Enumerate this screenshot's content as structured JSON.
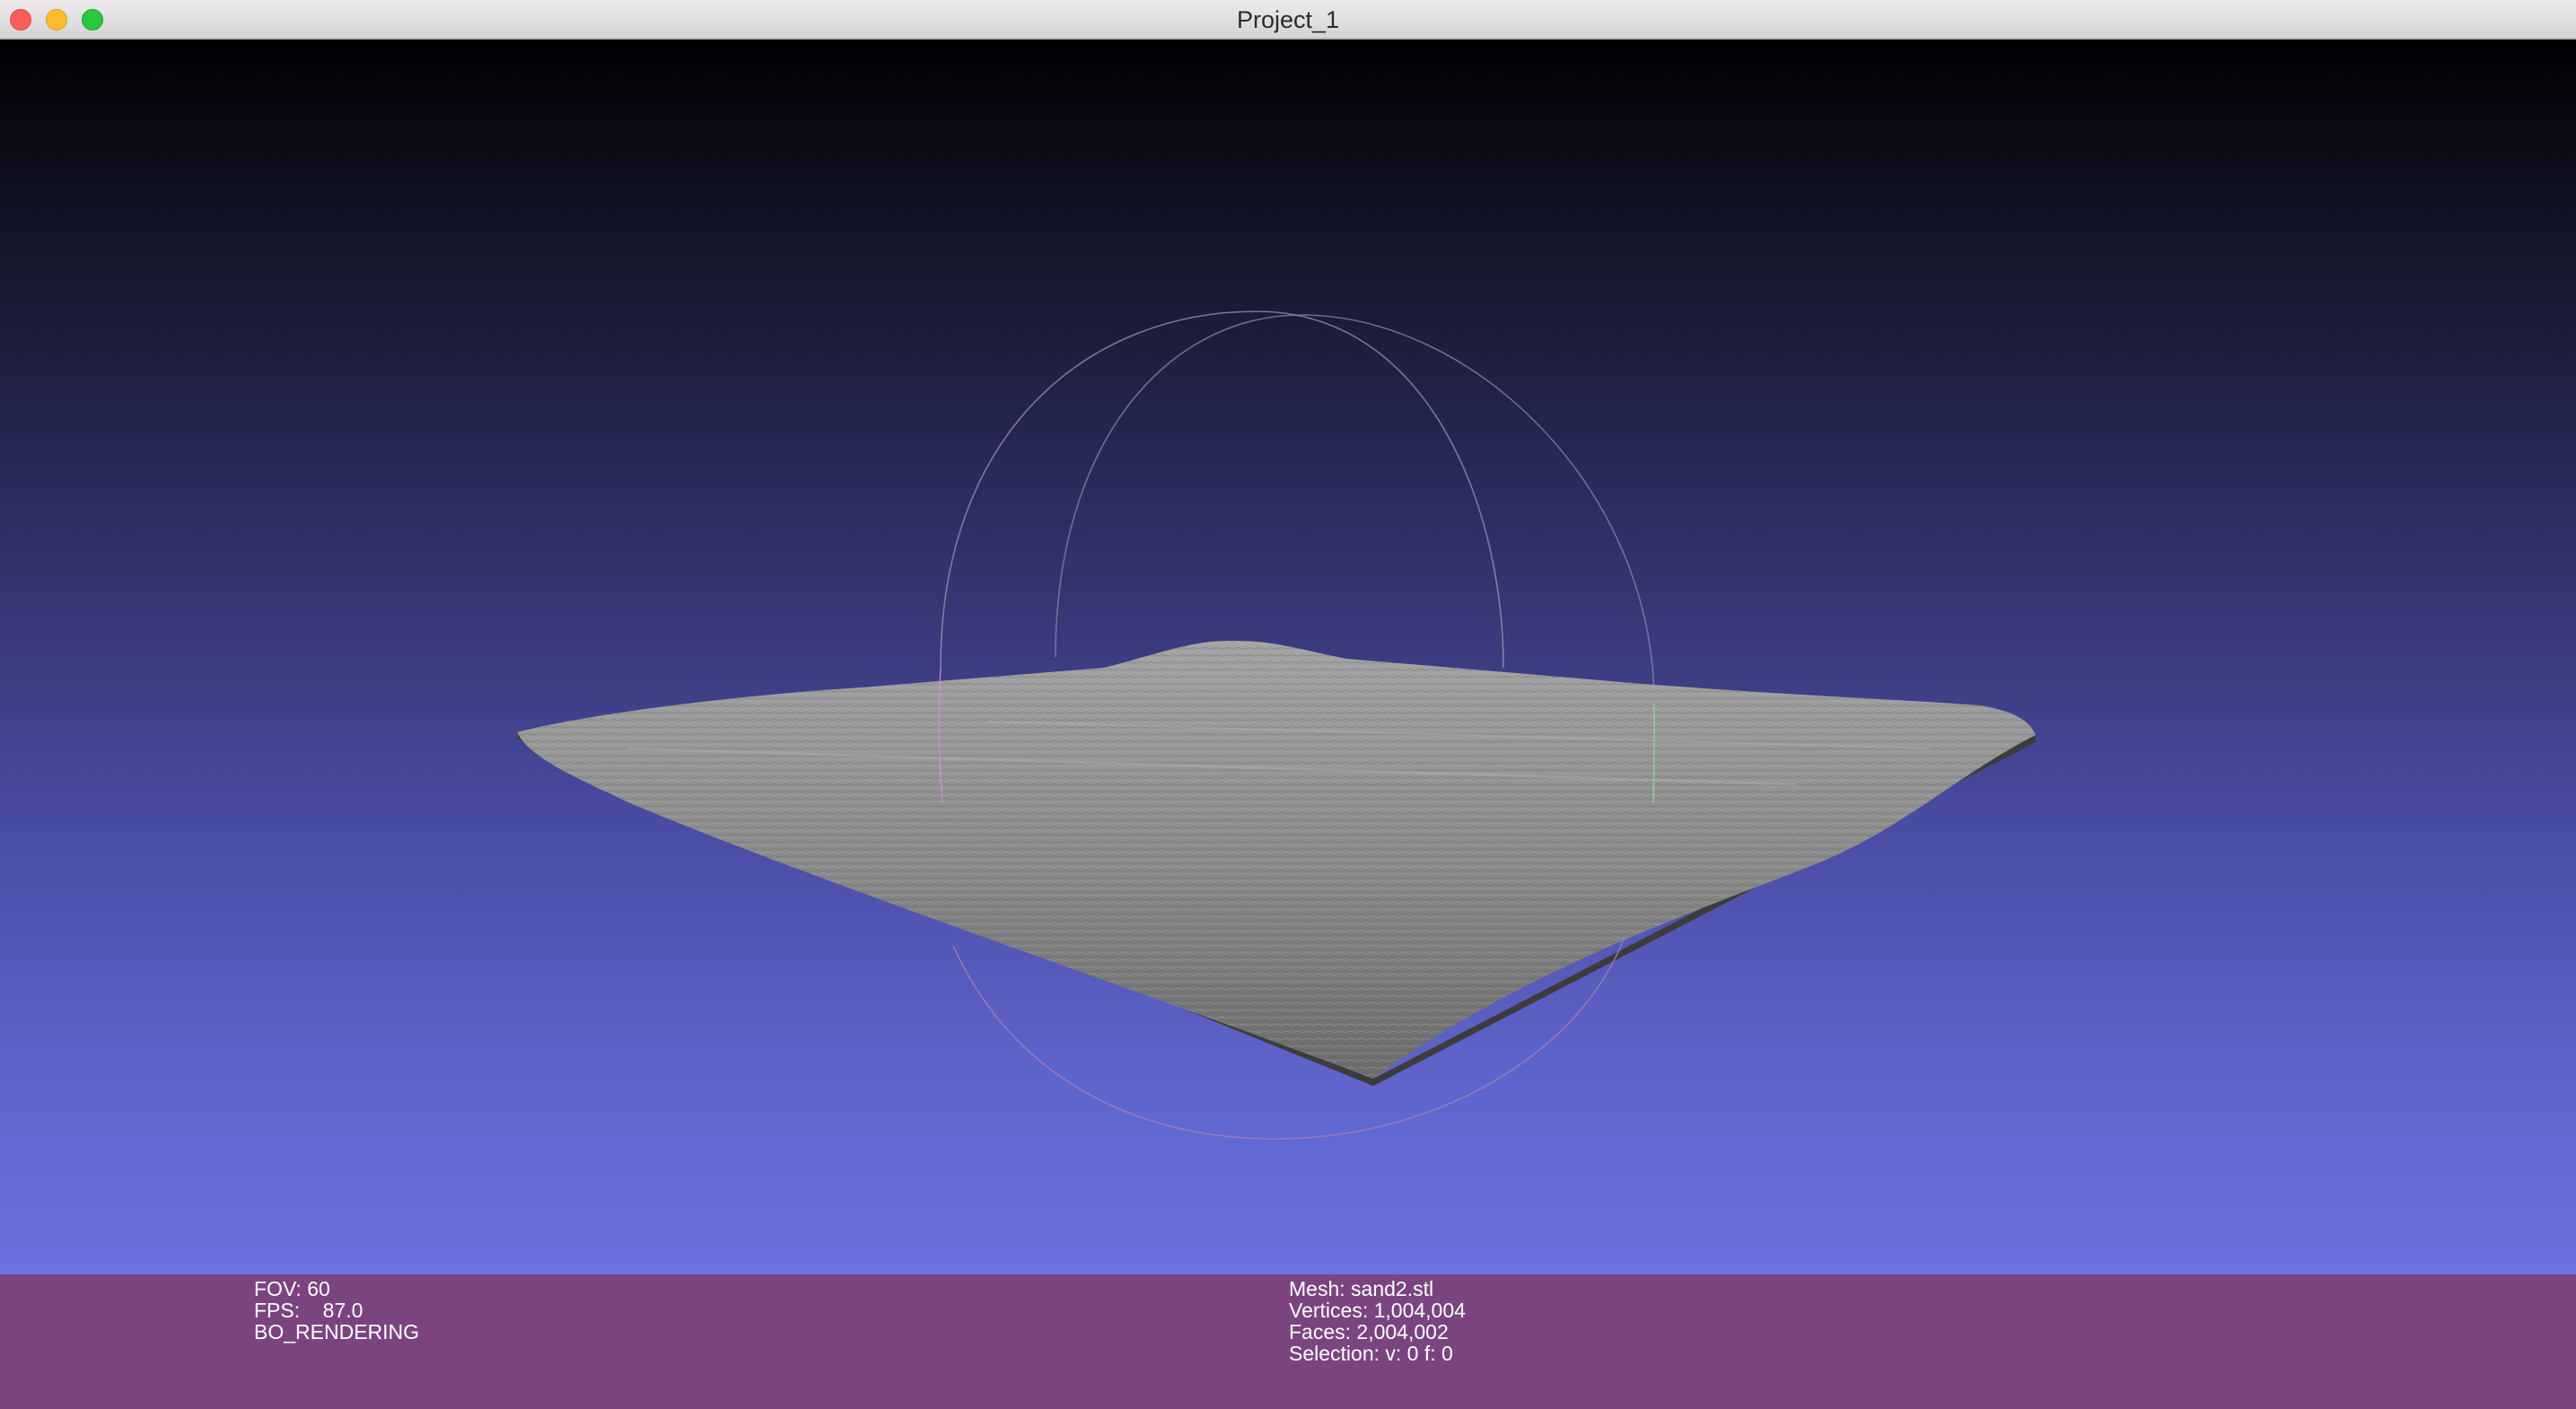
{
  "window": {
    "title": "Project_1"
  },
  "viewport": {
    "background_top": "#010103",
    "background_bottom": "#6d71e1",
    "mesh_color": "#8c8c8c"
  },
  "info_bar": {
    "background": "#7b4481",
    "left": {
      "fov": "FOV: 60",
      "fps": "FPS:    87.0",
      "render_mode": "BO_RENDERING"
    },
    "right": {
      "mesh": "Mesh: sand2.stl",
      "vertices": "Vertices: 1,004,004",
      "faces": "Faces: 2,004,002",
      "selection": "Selection: v: 0 f: 0"
    }
  }
}
